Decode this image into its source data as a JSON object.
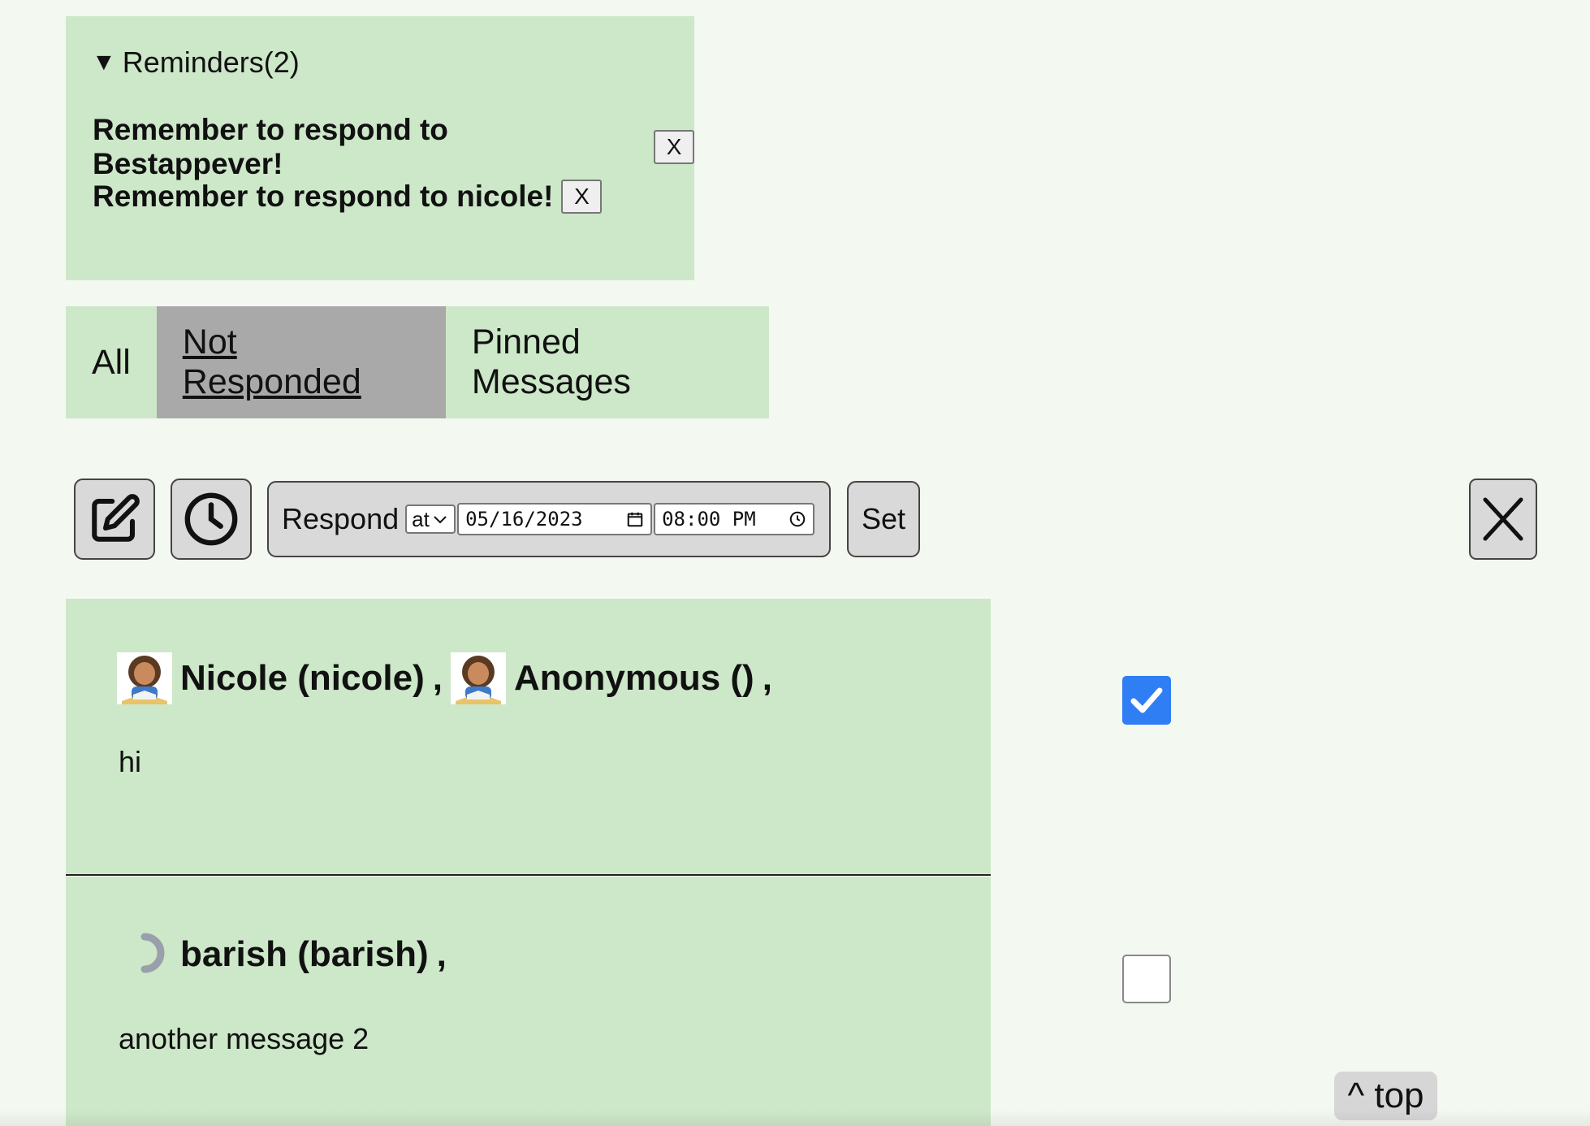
{
  "reminders": {
    "summary": "Reminders(2)",
    "items": [
      {
        "text": "Remember to respond to Bestappever!",
        "dismiss": "X"
      },
      {
        "text": "Remember to respond to nicole!",
        "dismiss": "X"
      }
    ]
  },
  "tabs": [
    {
      "label": "All",
      "active": false
    },
    {
      "label": "Not Responded",
      "active": true
    },
    {
      "label": "Pinned Messages",
      "active": false
    }
  ],
  "toolbar": {
    "edit_icon": "edit-icon",
    "clock_icon": "clock-icon",
    "respond_label": "Respond",
    "mode_select": "at",
    "date_value": "05/16/2023",
    "time_value": "08:00 PM",
    "set_label": "Set",
    "close_icon": "close-icon"
  },
  "messages": [
    {
      "authors": [
        {
          "name": "Nicole (nicole)",
          "avatar": "student-emoji"
        },
        {
          "name": "Anonymous ()",
          "avatar": "student-emoji"
        }
      ],
      "separator": ",",
      "text": "hi",
      "selected": true
    },
    {
      "authors": [
        {
          "name": "barish (barish)",
          "avatar": "loading-spinner"
        }
      ],
      "separator": ",",
      "text": "another message 2",
      "selected": false
    }
  ],
  "top_link": "^ top",
  "colors": {
    "page_bg": "#f3f8f1",
    "panel_bg": "#cde7c9",
    "active_tab": "#a9a9a9",
    "button_bg": "#d9d9d9",
    "checkbox_checked": "#2f7ef4"
  }
}
